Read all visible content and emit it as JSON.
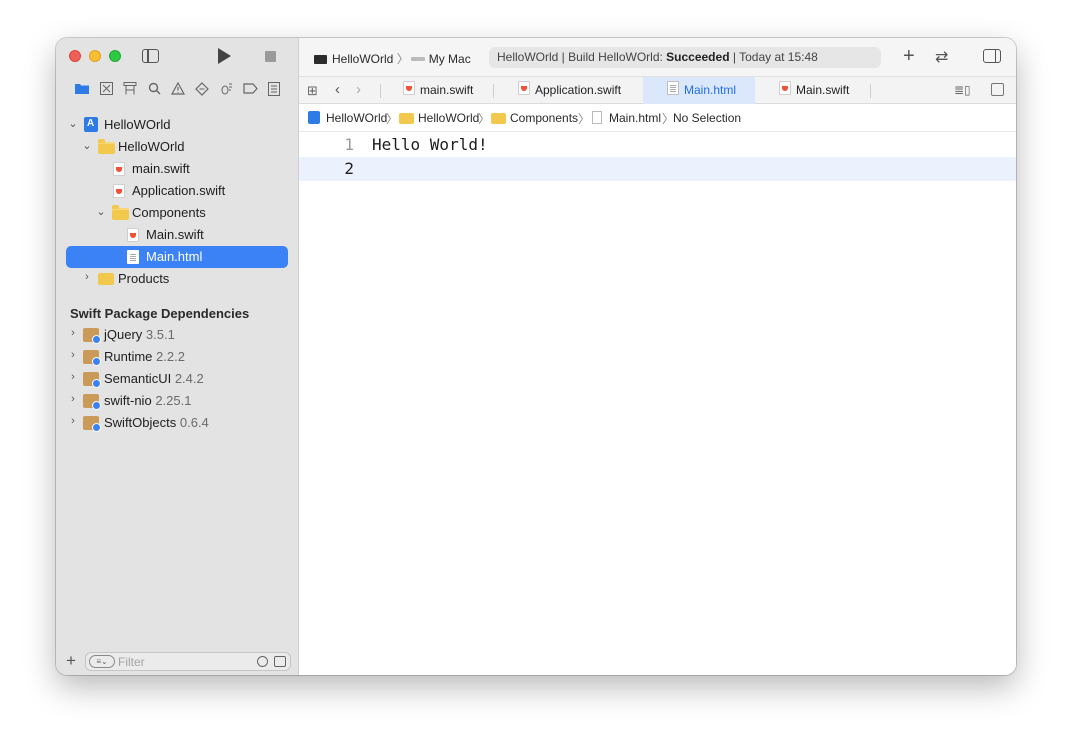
{
  "window": {
    "colors": {
      "accent": "#3b82f6",
      "close": "#ee5f57",
      "minimize": "#f6be30",
      "zoom": "#2ec842"
    }
  },
  "toolbar": {
    "scheme": "HelloWOrld",
    "destination": "My Mac",
    "status_prefix": "HelloWOrld | Build HelloWOrld: ",
    "status_result": "Succeeded",
    "status_time": " | Today at 15:48"
  },
  "navigator_icons": [
    "folder-icon",
    "source-control-icon",
    "symbol-icon",
    "search-icon",
    "issue-icon",
    "test-icon",
    "debug-icon",
    "breakpoint-icon",
    "report-icon"
  ],
  "sidebar": {
    "tree": [
      {
        "label": "HelloWOrld"
      },
      {
        "label": "HelloWOrld"
      },
      {
        "label": "main.swift"
      },
      {
        "label": "Application.swift"
      },
      {
        "label": "Components"
      },
      {
        "label": "Main.swift"
      },
      {
        "label": "Main.html"
      },
      {
        "label": "Products"
      }
    ],
    "packages_heading": "Swift Package Dependencies",
    "packages": [
      {
        "name": "jQuery",
        "version": "3.5.1"
      },
      {
        "name": "Runtime",
        "version": "2.2.2"
      },
      {
        "name": "SemanticUI",
        "version": "2.4.2"
      },
      {
        "name": "swift-nio",
        "version": "2.25.1"
      },
      {
        "name": "SwiftObjects",
        "version": "0.6.4"
      }
    ],
    "filter_placeholder": "Filter"
  },
  "tabs": [
    {
      "label": "main.swift"
    },
    {
      "label": "Application.swift"
    },
    {
      "label": "Main.html"
    },
    {
      "label": "Main.swift"
    }
  ],
  "jumpbar": [
    "HelloWOrld",
    "HelloWOrld",
    "Components",
    "Main.html",
    "No Selection"
  ],
  "editor": {
    "lines": [
      {
        "number": "1",
        "text": "Hello World!"
      },
      {
        "number": "2",
        "text": ""
      }
    ]
  }
}
